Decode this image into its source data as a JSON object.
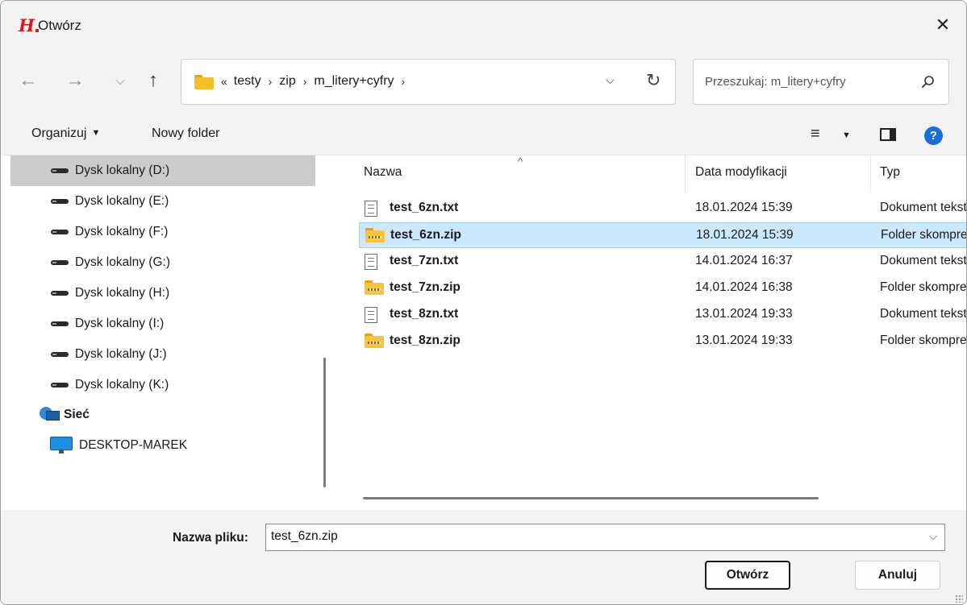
{
  "window": {
    "title": "Otwórz",
    "app_icon_letter": "H",
    "close_glyph": "✕"
  },
  "nav": {
    "back_glyph": "←",
    "forward_glyph": "→",
    "recent_glyph": "⌵",
    "up_glyph": "↑",
    "address": {
      "overflow": "«",
      "crumbs": [
        "testy",
        "zip",
        "m_litery+cyfry"
      ],
      "separator": "›",
      "dropdown_glyph": "⌵",
      "refresh_glyph": "↻"
    },
    "search": {
      "placeholder": "Przeszukaj: m_litery+cyfry",
      "icon": "search-icon"
    }
  },
  "toolbar": {
    "organize_label": "Organizuj",
    "caret": "▼",
    "new_folder_label": "Nowy folder",
    "view_glyph": "≡",
    "help_glyph": "?"
  },
  "sidebar": {
    "items": [
      {
        "label": "Dysk lokalny (D:)",
        "icon": "drive-icon",
        "selected": true
      },
      {
        "label": "Dysk lokalny (E:)",
        "icon": "drive-icon"
      },
      {
        "label": "Dysk lokalny (F:)",
        "icon": "drive-icon"
      },
      {
        "label": "Dysk lokalny (G:)",
        "icon": "drive-icon"
      },
      {
        "label": "Dysk lokalny (H:)",
        "icon": "drive-icon"
      },
      {
        "label": "Dysk lokalny (I:)",
        "icon": "drive-icon"
      },
      {
        "label": "Dysk lokalny (J:)",
        "icon": "drive-icon"
      },
      {
        "label": "Dysk lokalny (K:)",
        "icon": "drive-icon"
      },
      {
        "label": "Sieć",
        "icon": "network-icon"
      },
      {
        "label": "DESKTOP-MAREK",
        "icon": "computer-icon"
      }
    ]
  },
  "files": {
    "sort_glyph": "^",
    "columns": {
      "name": "Nazwa",
      "date": "Data modyfikacji",
      "type": "Typ"
    },
    "rows": [
      {
        "name": "test_6zn.txt",
        "date": "18.01.2024 15:39",
        "type": "Dokument tekstowy",
        "icon": "text-file-icon"
      },
      {
        "name": "test_6zn.zip",
        "date": "18.01.2024 15:39",
        "type": "Folder skompresowany",
        "icon": "zip-folder-icon",
        "selected": true
      },
      {
        "name": "test_7zn.txt",
        "date": "14.01.2024 16:37",
        "type": "Dokument tekstowy",
        "icon": "text-file-icon"
      },
      {
        "name": "test_7zn.zip",
        "date": "14.01.2024 16:38",
        "type": "Folder skompresowany",
        "icon": "zip-folder-icon"
      },
      {
        "name": "test_8zn.txt",
        "date": "13.01.2024 19:33",
        "type": "Dokument tekstowy",
        "icon": "text-file-icon"
      },
      {
        "name": "test_8zn.zip",
        "date": "13.01.2024 19:33",
        "type": "Folder skompresowany",
        "icon": "zip-folder-icon"
      }
    ]
  },
  "footer": {
    "filename_label": "Nazwa pliku:",
    "filename_value": "test_6zn.zip",
    "dropdown_glyph": "⌵",
    "open_label": "Otwórz",
    "cancel_label": "Anuluj"
  },
  "colors": {
    "selection_bg": "#cce8ff",
    "selection_border": "#99d1ff",
    "sidebar_selected": "#cccccc",
    "help_blue": "#1a6cd6",
    "brand_red": "#d81a1a"
  }
}
